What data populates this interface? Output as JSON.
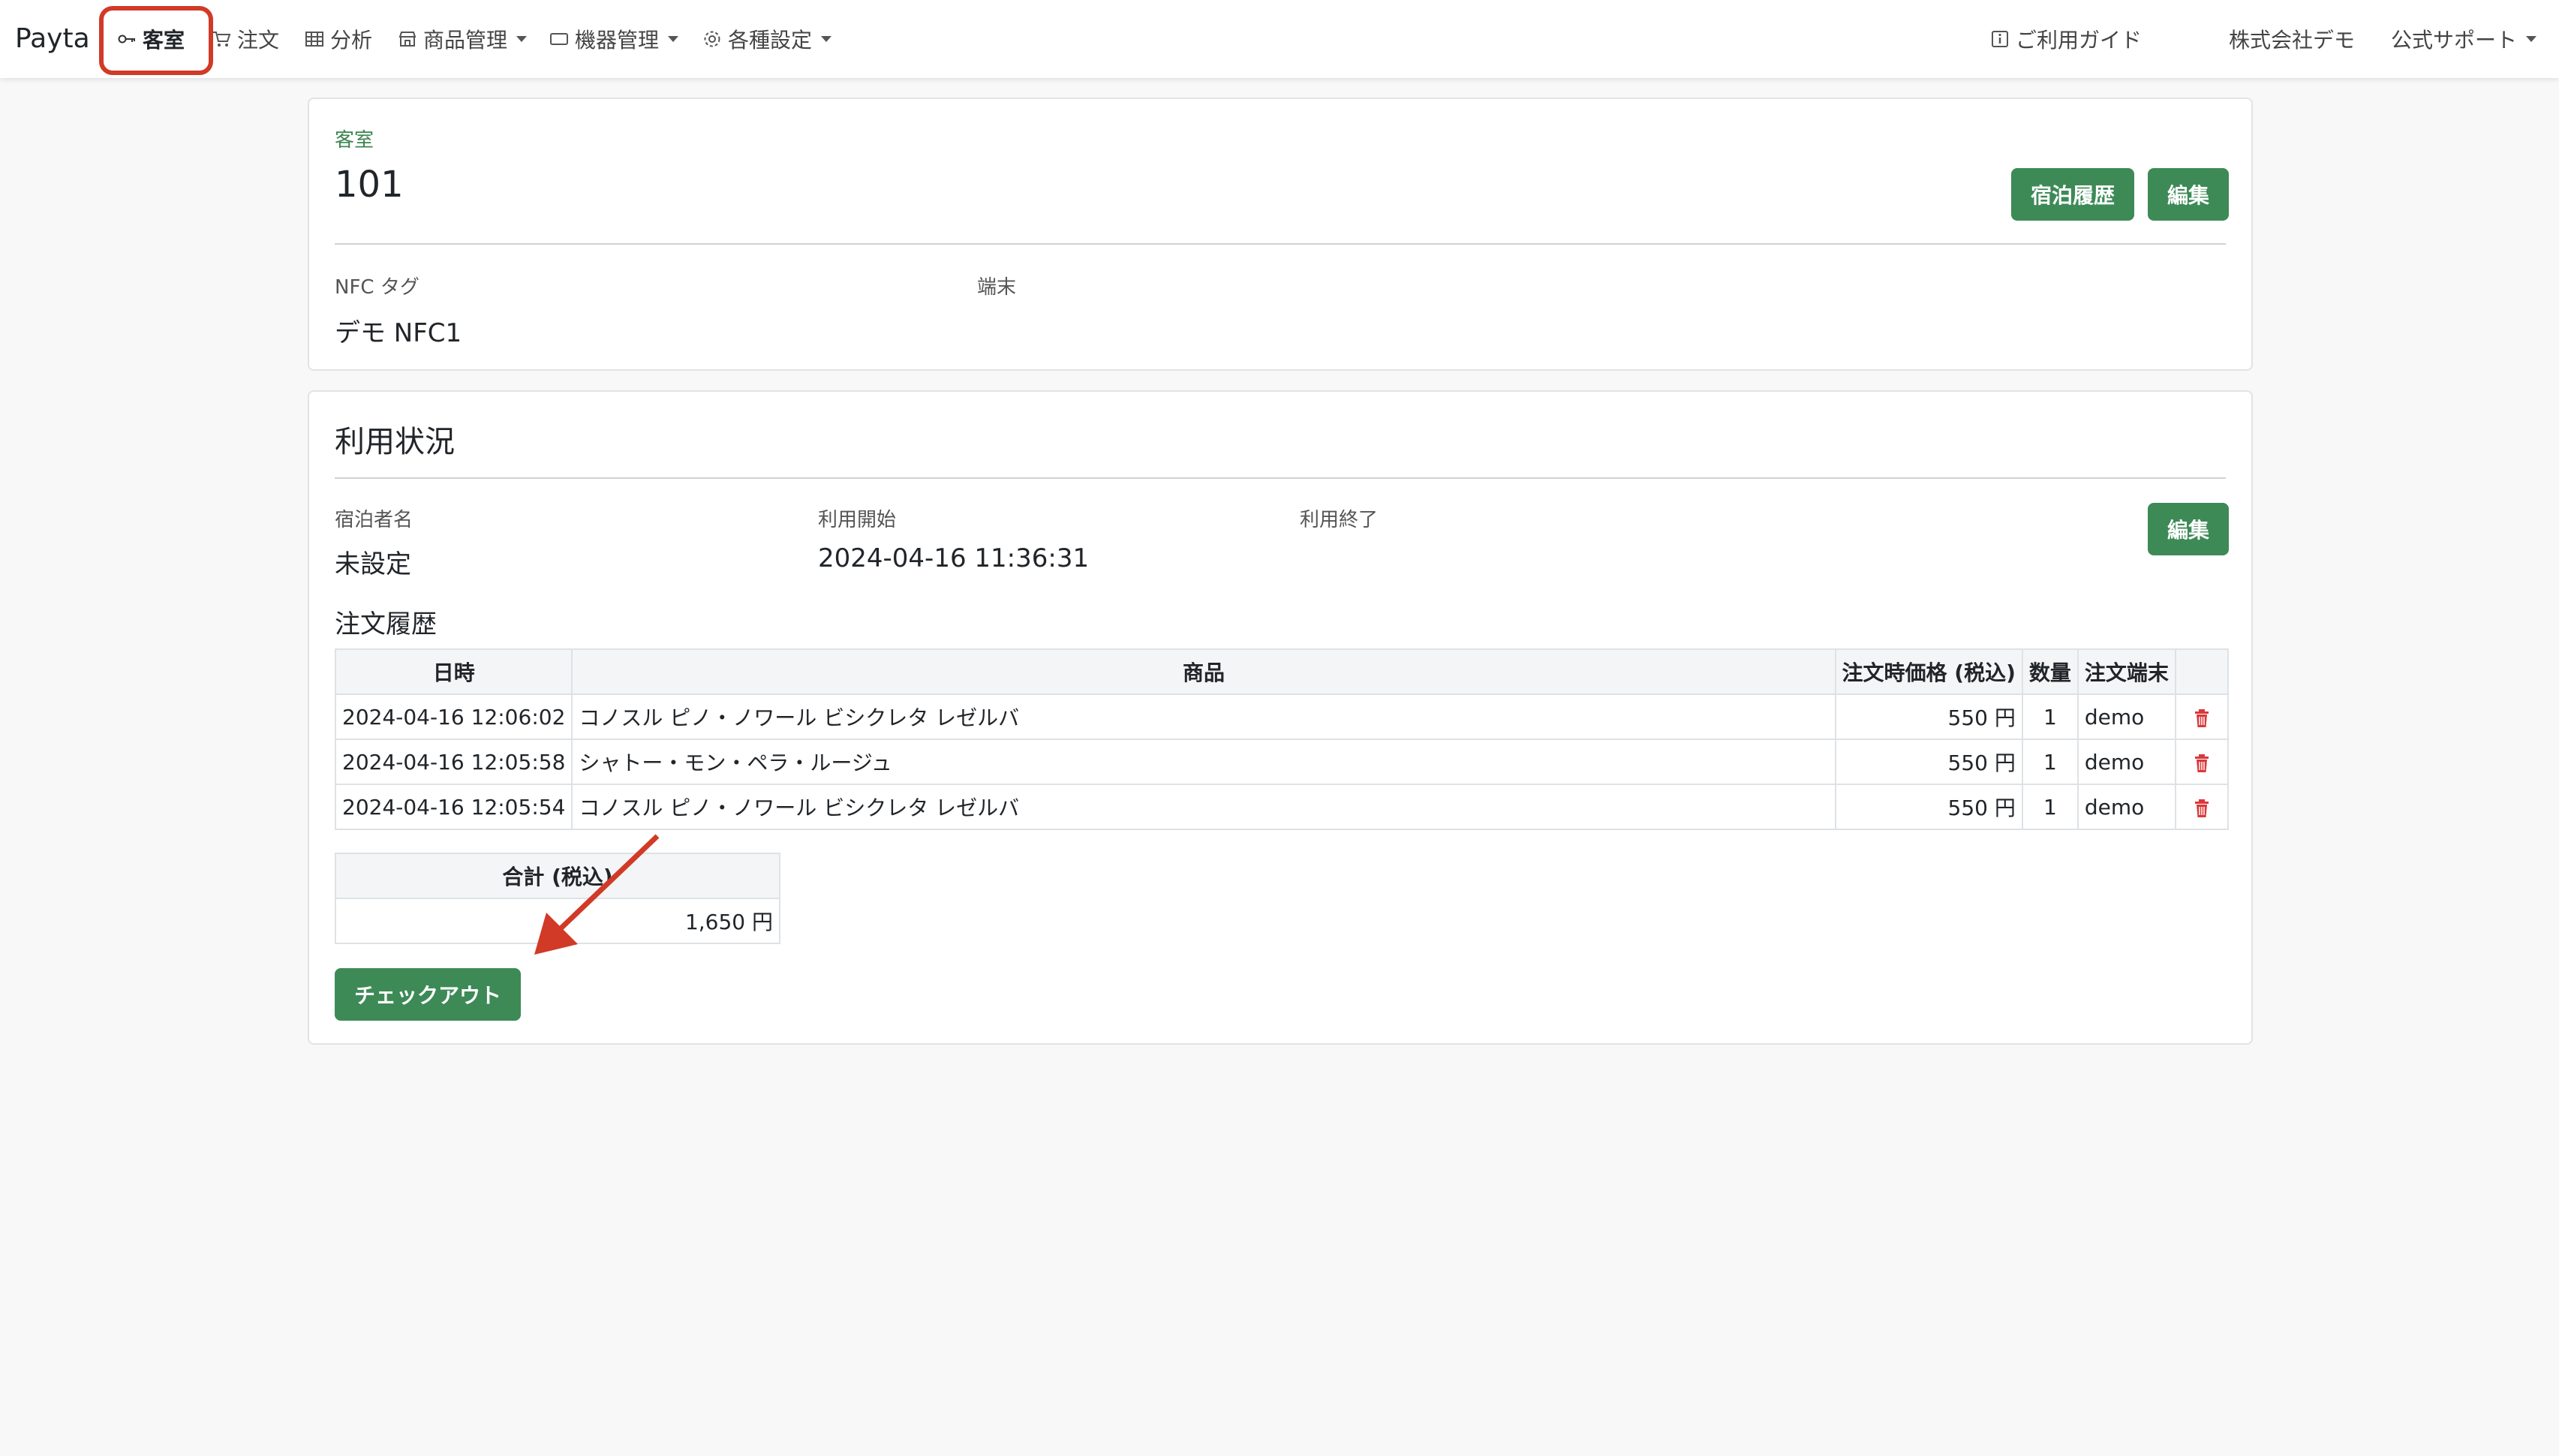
{
  "nav": {
    "brand": "Payta",
    "items": [
      {
        "label": "客室",
        "icon": "key-icon",
        "active": true
      },
      {
        "label": "注文",
        "icon": "cart-icon"
      },
      {
        "label": "分析",
        "icon": "table-icon"
      },
      {
        "label": "商品管理",
        "icon": "shop-icon",
        "dropdown": true
      },
      {
        "label": "機器管理",
        "icon": "device-icon",
        "dropdown": true
      },
      {
        "label": "各種設定",
        "icon": "gear-icon",
        "dropdown": true
      }
    ],
    "right": {
      "guide": "ご利用ガイド",
      "company": "株式会社デモ",
      "support": "公式サポート"
    }
  },
  "room": {
    "section_label": "客室",
    "number": "101",
    "history_button": "宿泊履歴",
    "edit_button": "編集",
    "nfc_label": "NFC タグ",
    "nfc_value": "デモ NFC1",
    "terminal_label": "端末"
  },
  "usage": {
    "title": "利用状況",
    "guest_label": "宿泊者名",
    "guest_value": "未設定",
    "start_label": "利用開始",
    "start_value": "2024-04-16 11:36:31",
    "end_label": "利用終了",
    "edit_button": "編集"
  },
  "orders": {
    "title": "注文履歴",
    "headers": [
      "日時",
      "商品",
      "注文時価格 (税込)",
      "数量",
      "注文端末"
    ],
    "rows": [
      {
        "datetime": "2024-04-16 12:06:02",
        "product": "コノスル ピノ・ノワール ビシクレタ レゼルバ",
        "price": "550 円",
        "qty": "1",
        "terminal": "demo"
      },
      {
        "datetime": "2024-04-16 12:05:58",
        "product": "シャトー・モン・ペラ・ルージュ",
        "price": "550 円",
        "qty": "1",
        "terminal": "demo"
      },
      {
        "datetime": "2024-04-16 12:05:54",
        "product": "コノスル ピノ・ノワール ビシクレタ レゼルバ",
        "price": "550 円",
        "qty": "1",
        "terminal": "demo"
      }
    ]
  },
  "total": {
    "header": "合計 (税込)",
    "value": "1,650 円"
  },
  "checkout_button": "チェックアウト",
  "colors": {
    "accent": "#3d8a57",
    "highlight": "#d13a26",
    "delete": "#d9383a"
  }
}
